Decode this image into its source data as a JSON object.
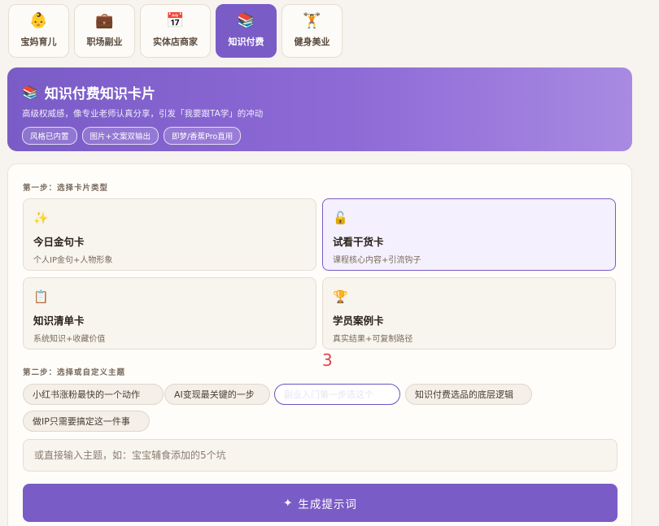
{
  "tabs": [
    {
      "icon": "👶",
      "icon_name": "baby-icon",
      "label": "宝妈育儿"
    },
    {
      "icon": "💼",
      "icon_name": "briefcase-icon",
      "label": "职场副业"
    },
    {
      "icon": "📅",
      "icon_name": "calendar-icon",
      "label": "实体店商家"
    },
    {
      "icon": "📚",
      "icon_name": "books-icon",
      "label": "知识付费"
    },
    {
      "icon": "🏋",
      "icon_name": "weightlifter-icon",
      "label": "健身美业"
    }
  ],
  "hero": {
    "icon": "📚",
    "title": "知识付费知识卡片",
    "subtitle": "高级权威感，像专业老师认真分享，引发「我要跟TA学」的冲动",
    "tags": [
      "风格已内置",
      "图片+文案双输出",
      "即梦/香蕉Pro直用"
    ]
  },
  "step1": {
    "label": "第一步：选择卡片类型",
    "cards": [
      {
        "icon": "✨",
        "icon_name": "sparkles-icon",
        "title": "今日金句卡",
        "desc": "个人IP金句+人物形象"
      },
      {
        "icon": "🔓",
        "icon_name": "unlock-icon",
        "title": "试看干货卡",
        "desc": "课程核心内容+引流钩子"
      },
      {
        "icon": "📋",
        "icon_name": "clipboard-icon",
        "title": "知识清单卡",
        "desc": "系统知识+收藏价值"
      },
      {
        "icon": "🏆",
        "icon_name": "trophy-icon",
        "title": "学员案例卡",
        "desc": "真实结果+可复制路径"
      }
    ]
  },
  "step2": {
    "label": "第二步：选择或自定义主题",
    "chips": [
      "小红书涨粉最快的一个动作",
      "AI变现最关键的一步",
      "副业入门第一步选这个",
      "知识付费选品的底层逻辑",
      "做IP只需要搞定这一件事"
    ]
  },
  "input": {
    "placeholder": "或直接输入主题，如：宝宝辅食添加的5个坑",
    "value": ""
  },
  "generate": {
    "icon": "✦",
    "label": "生成提示词"
  },
  "marker": "3",
  "colors": {
    "accent": "#7a5cc7",
    "background": "#f7f3ee",
    "marker": "#e0454f"
  }
}
